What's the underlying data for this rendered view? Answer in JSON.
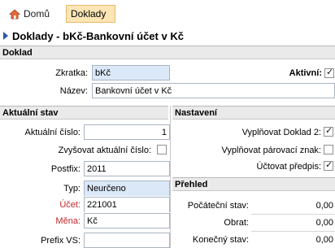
{
  "tabs": [
    {
      "label": "Domů",
      "icon": "home-icon"
    },
    {
      "label": "Doklady",
      "active": true
    }
  ],
  "page_title": "Doklady - bKč-Bankovní účet v Kč",
  "doklad": {
    "header": "Doklad",
    "zkratka_label": "Zkratka:",
    "zkratka_value": "bKč",
    "nazev_label": "Název:",
    "nazev_value": "Bankovní účet v Kč",
    "aktivni_label": "Aktivní:",
    "aktivni_checked": true
  },
  "aktualni_stav": {
    "header": "Aktuální stav",
    "cislo_label": "Aktuální číslo:",
    "cislo_value": "1",
    "zvysovat_label": "Zvyšovat aktuální číslo:",
    "zvysovat_checked": false,
    "postfix_label": "Postfix:",
    "postfix_value": "2011",
    "typ_label": "Typ:",
    "typ_value": "Neurčeno",
    "ucet_label": "Účet:",
    "ucet_value": "221001",
    "mena_label": "Měna:",
    "mena_value": "Kč",
    "prefix_label": "Prefix VS:",
    "prefix_value": ""
  },
  "nastaveni": {
    "header": "Nastavení",
    "vyplnovat_doklad_label": "Vyplňovat Doklad 2:",
    "vyplnovat_doklad_checked": true,
    "vyplnovat_parovaci_label": "Vyplňovat párovací znak:",
    "vyplnovat_parovaci_checked": false,
    "uctovat_label": "Účtovat předpis:",
    "uctovat_checked": true
  },
  "prehled": {
    "header": "Přehled",
    "pocatecni_label": "Počáteční stav:",
    "pocatecni_value": "0,00",
    "obrat_label": "Obrat:",
    "obrat_value": "0,00",
    "konecny_label": "Konečný stav:",
    "konecny_value": "0,00"
  },
  "colors": {
    "active_tab_bg": "#fde6b5",
    "field_highlight": "#dbe8f8",
    "required_label": "#c0282a",
    "title_arrow": "#2b5aa8"
  }
}
